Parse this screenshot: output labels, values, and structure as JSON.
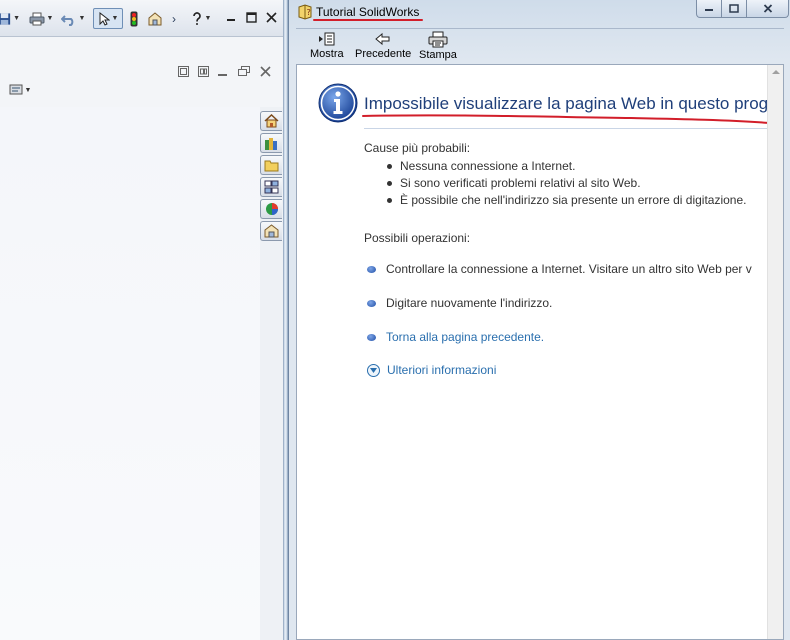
{
  "help_window": {
    "title": "Tutorial SolidWorks",
    "toolbar": {
      "show_label": "Mostra",
      "back_label": "Precedente",
      "print_label": "Stampa"
    },
    "error_page": {
      "title": "Impossibile visualizzare la pagina Web in questo program",
      "causes_heading": "Cause più probabili:",
      "causes": [
        "Nessuna connessione a Internet.",
        "Si sono verificati problemi relativi al sito Web.",
        "È possibile che nell'indirizzo sia presente un errore di digitazione."
      ],
      "actions_heading": "Possibili operazioni:",
      "actions": [
        "Controllare la connessione a Internet. Visitare un altro sito Web per v",
        "Digitare nuovamente l'indirizzo."
      ],
      "back_link": "Torna alla pagina precedente.",
      "more_info": "Ulteriori informazioni"
    }
  },
  "solidworks": {
    "toolbar_overflow": "›"
  },
  "colors": {
    "annotation_red": "#d21e2a",
    "title_blue": "#1f3f7a",
    "link_blue": "#2a6fae"
  },
  "icons": {
    "sw_toolbar": [
      "save-icon",
      "print-icon",
      "undo-icon",
      "select-arrow-icon",
      "traffic-light-icon",
      "options-icon",
      "help-icon",
      "restore-icon",
      "close-icon"
    ],
    "taskpane": [
      "home-icon",
      "design-library-icon",
      "file-explorer-icon",
      "view-palette-icon",
      "appearances-icon",
      "custom-properties-icon"
    ],
    "help_window": [
      "help-book-icon",
      "show-icon",
      "back-arrow-icon",
      "print-icon",
      "info-icon",
      "expand-circle-icon"
    ]
  }
}
